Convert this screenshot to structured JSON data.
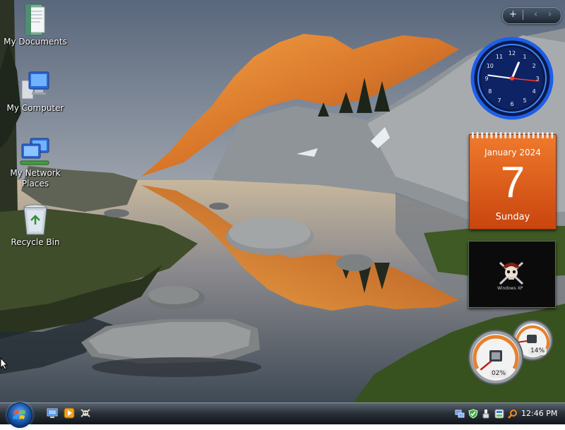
{
  "desktop": {
    "icons": [
      {
        "label": "My Documents",
        "icon": "documents-folder-icon"
      },
      {
        "label": "My Computer",
        "icon": "computer-icon"
      },
      {
        "label": "My Network Places",
        "icon": "network-places-icon"
      },
      {
        "label": "Recycle Bin",
        "icon": "recycle-bin-icon"
      }
    ]
  },
  "sidebar": {
    "toolbar": {
      "add_label": "+",
      "prev_label": "‹",
      "next_label": "›"
    },
    "clock": {
      "hour": 12,
      "minute": 46,
      "second": 16
    },
    "calendar": {
      "month_year": "January 2024",
      "day": "7",
      "weekday": "Sunday"
    },
    "slideshow": {
      "caption": "Windows XP"
    },
    "cpu_meter": {
      "cpu_percent": 2,
      "memory_percent": 14,
      "cpu_label": "02%",
      "memory_label": "14%"
    }
  },
  "taskbar": {
    "start_icon": "windows-logo-icon",
    "quick_launch": [
      {
        "icon": "show-desktop-icon"
      },
      {
        "icon": "media-player-icon"
      },
      {
        "icon": "pirate-app-icon"
      }
    ],
    "tray": [
      {
        "icon": "network-icon"
      },
      {
        "icon": "security-shield-icon"
      },
      {
        "icon": "usb-device-icon"
      },
      {
        "icon": "update-icon"
      },
      {
        "icon": "search-icon"
      }
    ],
    "time": "12:46 PM"
  },
  "colors": {
    "calendar_orange": "#e0621c",
    "clock_blue": "#1e5fe8",
    "taskbar_dark": "#1f252d"
  }
}
